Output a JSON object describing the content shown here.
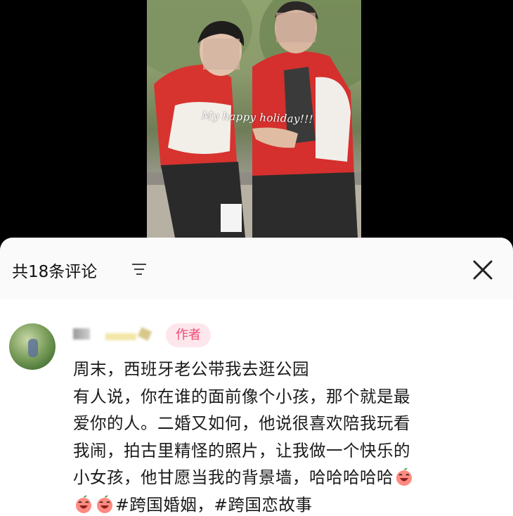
{
  "photo": {
    "caption": "My happy holiday!!!"
  },
  "comments_panel": {
    "title": "共18条评论",
    "sort_icon": "sort-icon",
    "close_icon": "close-icon"
  },
  "comment": {
    "author_badge": "作者",
    "lines": [
      "周末，西班牙老公带我去逛公园",
      "有人说，你在谁的面前像个小孩，那个就是最",
      "爱你的人。二婚又如何，他说很喜欢陪我玩看",
      "我闹，拍古里精怪的照片，让我做一个快乐的",
      "小女孩，他甘愿当我的背景墙，哈哈哈哈哈"
    ],
    "hashtag_1": "#跨国婚姻",
    "separator": "，",
    "hashtag_2": "#跨国恋故事",
    "emoji_icon": "laughing-peach-emoji-icon",
    "colors": {
      "badge_bg": "#fde7ec",
      "badge_text": "#f04a74"
    }
  }
}
